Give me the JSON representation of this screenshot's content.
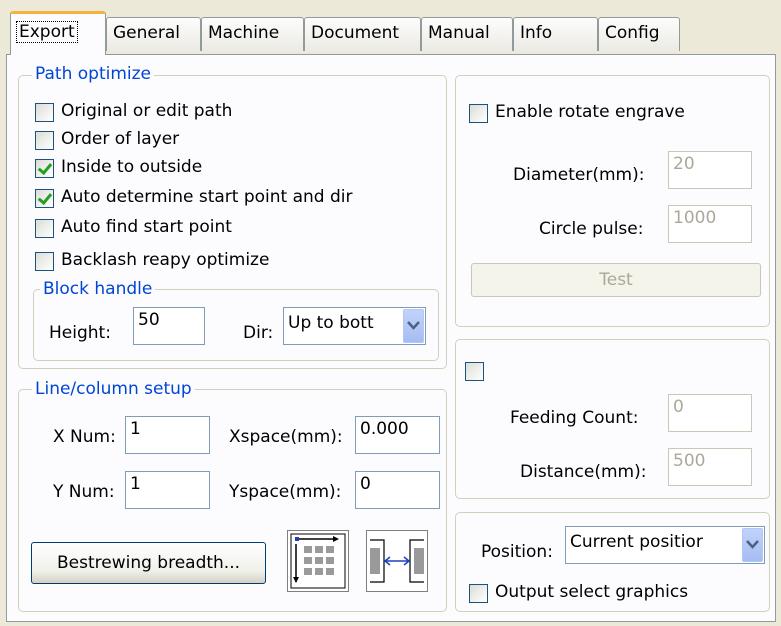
{
  "tabs": [
    {
      "label": "Export",
      "active": true
    },
    {
      "label": "General"
    },
    {
      "label": "Machine"
    },
    {
      "label": "Document"
    },
    {
      "label": "Manual"
    },
    {
      "label": "Info"
    },
    {
      "label": "Config"
    }
  ],
  "path_optimize": {
    "title": "Path optimize",
    "options": [
      {
        "label": "Original or edit path",
        "checked": false
      },
      {
        "label": "Order of layer",
        "checked": false
      },
      {
        "label": "Inside to outside",
        "checked": true
      },
      {
        "label": "Auto determine start point and dir",
        "checked": true
      },
      {
        "label": "Auto find start point",
        "checked": false
      },
      {
        "label": "Backlash reapy optimize",
        "checked": false
      }
    ],
    "block_handle": {
      "title": "Block handle",
      "height_label": "Height:",
      "height_value": "50",
      "dir_label": "Dir:",
      "dir_value": "Up to bott"
    }
  },
  "line_column": {
    "title": "Line/column setup",
    "x_num_label": "X Num:",
    "x_num_value": "1",
    "y_num_label": "Y Num:",
    "y_num_value": "1",
    "xspace_label": "Xspace(mm):",
    "xspace_value": "0.000",
    "yspace_label": "Yspace(mm):",
    "yspace_value": "0",
    "bestrewing_label": "Bestrewing breadth..."
  },
  "rotate": {
    "enable_label": "Enable rotate engrave",
    "enabled": false,
    "diameter_label": "Diameter(mm):",
    "diameter_value": "20",
    "pulse_label": "Circle pulse:",
    "pulse_value": "1000",
    "test_label": "Test"
  },
  "feeding": {
    "enabled": false,
    "count_label": "Feeding Count:",
    "count_value": "0",
    "distance_label": "Distance(mm):",
    "distance_value": "500"
  },
  "position": {
    "label": "Position:",
    "value": "Current positior",
    "output_label": "Output select graphics",
    "output_checked": false
  },
  "colors": {
    "accent": "#0046d5",
    "tab_highlight": "#f4b43c",
    "check": "#21a121"
  }
}
